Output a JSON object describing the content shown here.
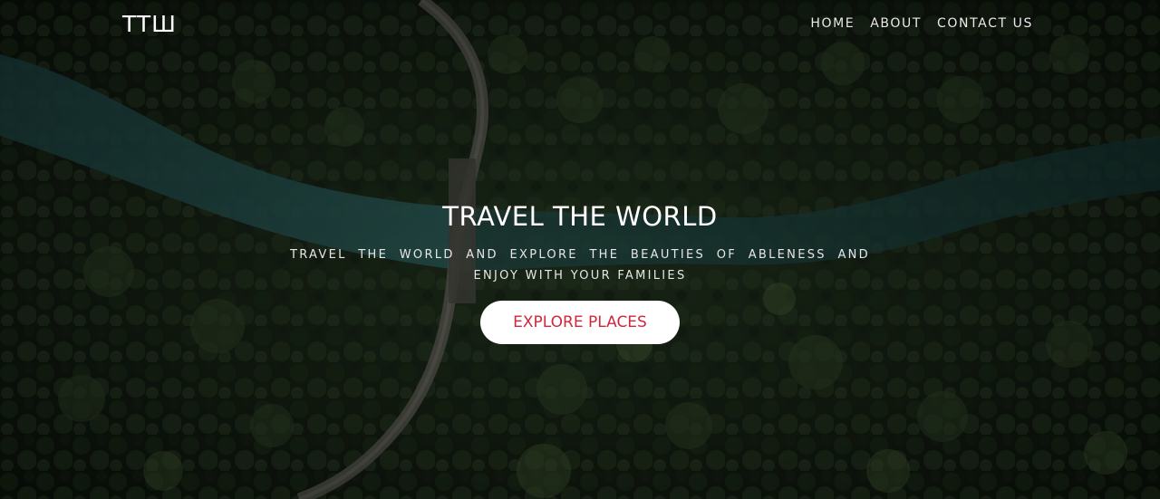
{
  "navbar": {
    "logo": "TTШ",
    "links": [
      "HOME",
      "ABOUT",
      "CONTACT US"
    ]
  },
  "hero": {
    "title": "TRAVEL THE WORLD",
    "subtitle": "TRAVEL THE WORLD AND EXPLORE THE BEAUTIES OF ABLENESS AND ENJOY WITH YOUR FAMILIES",
    "cta_label": "EXPLORE PLACES"
  },
  "colors": {
    "cta_text": "#d0283c",
    "cta_background": "#ffffff",
    "text": "#ffffff",
    "forest_dark": "#0d140c",
    "river": "#1f4a48"
  }
}
